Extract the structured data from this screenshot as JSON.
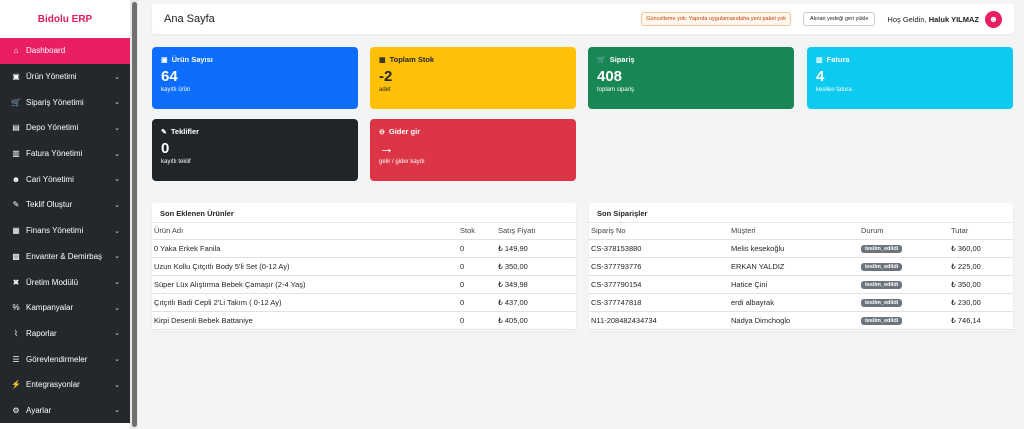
{
  "brand": {
    "name": "Bidolu ERP",
    "color": "#dc1f5a"
  },
  "sidebar": {
    "items": [
      {
        "label": "Dashboard",
        "icon": "home-icon",
        "glyph": "⌂",
        "active": true,
        "expandable": false
      },
      {
        "label": "Ürün Yönetimi",
        "icon": "box-icon",
        "glyph": "▣",
        "expandable": true
      },
      {
        "label": "Sipariş Yönetimi",
        "icon": "cart-icon",
        "glyph": "🛒",
        "expandable": true
      },
      {
        "label": "Depo Yönetimi",
        "icon": "warehouse-icon",
        "glyph": "▤",
        "expandable": true
      },
      {
        "label": "Fatura Yönetimi",
        "icon": "invoice-icon",
        "glyph": "▥",
        "expandable": true
      },
      {
        "label": "Cari Yönetimi",
        "icon": "users-icon",
        "glyph": "☻",
        "expandable": true
      },
      {
        "label": "Teklif Oluştur",
        "icon": "edit-icon",
        "glyph": "✎",
        "expandable": true
      },
      {
        "label": "Finans Yönetimi",
        "icon": "money-icon",
        "glyph": "▦",
        "expandable": true
      },
      {
        "label": "Envanter & Demirbaş",
        "icon": "inventory-icon",
        "glyph": "▩",
        "expandable": true
      },
      {
        "label": "Üretim Modülü",
        "icon": "tools-icon",
        "glyph": "✖",
        "expandable": true
      },
      {
        "label": "Kampanyalar",
        "icon": "percent-icon",
        "glyph": "%",
        "expandable": true
      },
      {
        "label": "Raporlar",
        "icon": "chart-icon",
        "glyph": "⌇",
        "expandable": true
      },
      {
        "label": "Görevlendirmeler",
        "icon": "tasks-icon",
        "glyph": "☰",
        "expandable": true
      },
      {
        "label": "Entegrasyonlar",
        "icon": "plug-icon",
        "glyph": "⚡",
        "expandable": true
      },
      {
        "label": "Ayarlar",
        "icon": "gear-icon",
        "glyph": "⚙",
        "expandable": true
      }
    ]
  },
  "header": {
    "title": "Ana Sayfa",
    "update_notice": "Güncelleme yok: Yaprıda uygulamasıdaha yeni paket yok",
    "revert_label": "Alınan yedeği geri yükle",
    "welcome_prefix": "Hoş Geldin,",
    "user_name": "Haluk YILMAZ"
  },
  "cards": [
    {
      "id": "urun",
      "title": "Ürün Sayısı",
      "value": "64",
      "sub": "kayıtlı ürün",
      "color": "#0d6efd",
      "icon": "box-icon",
      "glyph": "▣"
    },
    {
      "id": "stok",
      "title": "Toplam Stok",
      "value": "-2",
      "sub": "adet",
      "color": "#ffc107",
      "text": "#212529",
      "icon": "boxes-icon",
      "glyph": "▦"
    },
    {
      "id": "siparis",
      "title": "Sipariş",
      "value": "408",
      "sub": "toplam sipariş",
      "color": "#198754",
      "icon": "cart-icon",
      "glyph": "🛒"
    },
    {
      "id": "fatura",
      "title": "Fatura",
      "value": "4",
      "sub": "kesilen fatura",
      "color": "#0dcaf0",
      "icon": "file-icon",
      "glyph": "▥"
    },
    {
      "id": "teklif",
      "title": "Teklifler",
      "value": "0",
      "sub": "kayıtlı teklif",
      "color": "#212529",
      "icon": "edit-icon",
      "glyph": "✎"
    },
    {
      "id": "gider",
      "title": "Gider gir",
      "value": "→",
      "sub": "gelir / gider kaydı",
      "color": "#dc3545",
      "icon": "minus-circle-icon",
      "glyph": "⊖"
    }
  ],
  "products": {
    "title": "Son Eklenen Ürünler",
    "columns": [
      "Ürün Adı",
      "Stok",
      "Satış Fiyatı"
    ],
    "rows": [
      [
        "0 Yaka Erkek Fanila",
        "0",
        "₺ 149,90"
      ],
      [
        "Uzun Kollu Çıtçıtlı Body 5'li Set (0-12 Ay)",
        "0",
        "₺ 350,00"
      ],
      [
        "Süper Lüx Alıştırma Bebek Çamaşır (2-4 Yaş)",
        "0",
        "₺ 349,98"
      ],
      [
        "Çıtçıtlı Badi Cepli 2'Li Takım ( 0-12 Ay)",
        "0",
        "₺ 437,00"
      ],
      [
        "Kirpi Desenli Bebek Battaniye",
        "0",
        "₺ 405,00"
      ]
    ]
  },
  "orders": {
    "title": "Son Siparişler",
    "columns": [
      "Sipariş No",
      "Müşteri",
      "Durum",
      "Tutar"
    ],
    "rows": [
      [
        "CS-378153880",
        "Melis kesekoğlu",
        "teslim_edildi",
        "₺ 360,00"
      ],
      [
        "CS-377793776",
        "ERKAN YALDIZ",
        "teslim_edildi",
        "₺ 225,00"
      ],
      [
        "CS-377790154",
        "Hatice Çini",
        "teslim_edildi",
        "₺ 350,00"
      ],
      [
        "CS-377747818",
        "erdi albayrak",
        "teslim_edildi",
        "₺ 230,00"
      ],
      [
        "N11-208482434734",
        "Nadya Dimchoglo",
        "teslim_edildi",
        "₺ 746,14"
      ]
    ]
  }
}
